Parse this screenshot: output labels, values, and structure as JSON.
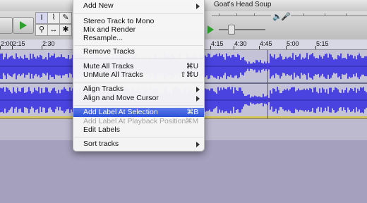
{
  "window": {
    "title": "Goat's Head Soup"
  },
  "timeline": {
    "labels": [
      "2:00",
      "2:15",
      "2:30",
      "4:15",
      "4:30",
      "4:45",
      "5:00",
      "5:15"
    ]
  },
  "menu": {
    "items": [
      {
        "label": "Add New",
        "shortcut": "",
        "submenu": true,
        "enabled": true,
        "highlighted": false
      },
      {
        "label": "Stereo Track to Mono",
        "shortcut": "",
        "submenu": false,
        "enabled": true,
        "highlighted": false
      },
      {
        "label": "Mix and Render",
        "shortcut": "",
        "submenu": false,
        "enabled": true,
        "highlighted": false
      },
      {
        "label": "Resample...",
        "shortcut": "",
        "submenu": false,
        "enabled": true,
        "highlighted": false
      },
      {
        "label": "Remove Tracks",
        "shortcut": "",
        "submenu": false,
        "enabled": true,
        "highlighted": false
      },
      {
        "label": "Mute All Tracks",
        "shortcut": "⌘U",
        "submenu": false,
        "enabled": true,
        "highlighted": false
      },
      {
        "label": "UnMute All Tracks",
        "shortcut": "⇧⌘U",
        "submenu": false,
        "enabled": true,
        "highlighted": false
      },
      {
        "label": "Align Tracks",
        "shortcut": "",
        "submenu": true,
        "enabled": true,
        "highlighted": false
      },
      {
        "label": "Align and Move Cursor",
        "shortcut": "",
        "submenu": true,
        "enabled": true,
        "highlighted": false
      },
      {
        "label": "Add Label At Selection",
        "shortcut": "⌘B",
        "submenu": false,
        "enabled": true,
        "highlighted": true
      },
      {
        "label": "Add Label At Playback Position",
        "shortcut": "⌘M",
        "submenu": false,
        "enabled": false,
        "highlighted": false
      },
      {
        "label": "Edit Labels",
        "shortcut": "",
        "submenu": false,
        "enabled": true,
        "highlighted": false
      },
      {
        "label": "Sort tracks",
        "shortcut": "",
        "submenu": true,
        "enabled": true,
        "highlighted": false
      }
    ]
  },
  "colors": {
    "waveform": "#4a43e0",
    "waveform_edge": "#2f2a9e",
    "menu_highlight": "#3158dc",
    "play_green": "#2fa02f"
  }
}
